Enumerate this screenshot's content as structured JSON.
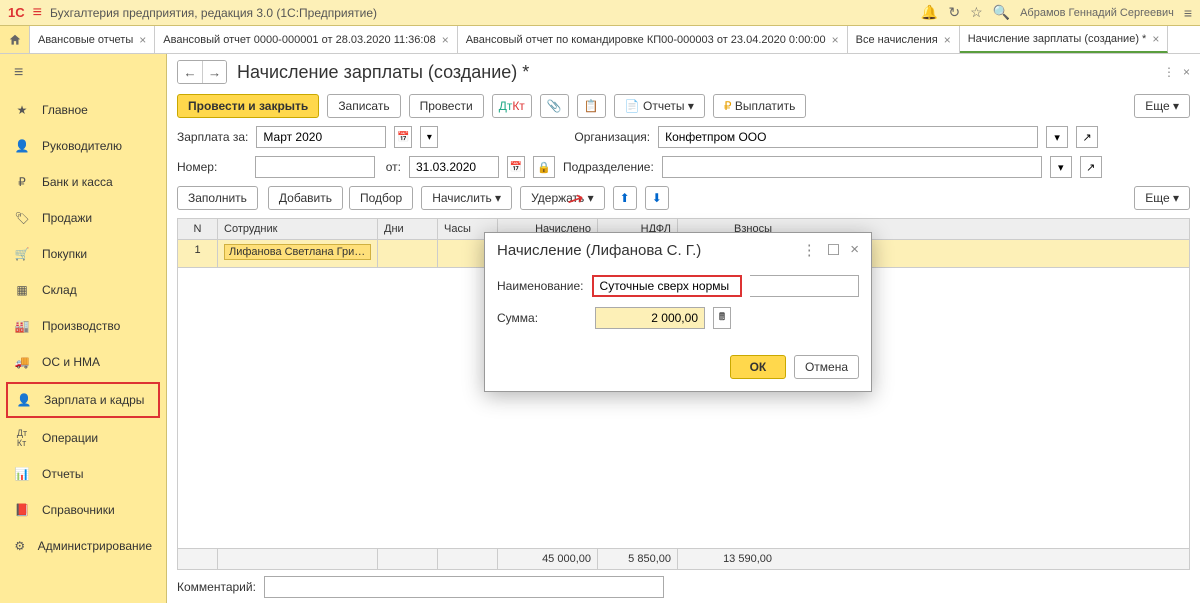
{
  "app": {
    "title": "Бухгалтерия предприятия, редакция 3.0   (1С:Предприятие)",
    "logo": "1C",
    "user": "Абрамов Геннадий Сергеевич"
  },
  "tabs": [
    {
      "label": "Авансовые отчеты"
    },
    {
      "label": "Авансовый отчет 0000-000001 от 28.03.2020 11:36:08"
    },
    {
      "label": "Авансовый отчет по командировке КП00-000003 от 23.04.2020 0:00:00"
    },
    {
      "label": "Все начисления"
    },
    {
      "label": "Начисление зарплаты (создание) *",
      "active": true
    }
  ],
  "sidebar": {
    "items": [
      {
        "label": "Главное",
        "icon": "star"
      },
      {
        "label": "Руководителю",
        "icon": "person"
      },
      {
        "label": "Банк и касса",
        "icon": "coin"
      },
      {
        "label": "Продажи",
        "icon": "sale"
      },
      {
        "label": "Покупки",
        "icon": "cart"
      },
      {
        "label": "Склад",
        "icon": "warehouse"
      },
      {
        "label": "Производство",
        "icon": "factory"
      },
      {
        "label": "ОС и НМА",
        "icon": "truck"
      },
      {
        "label": "Зарплата и кадры",
        "icon": "person2",
        "highlighted": true
      },
      {
        "label": "Операции",
        "icon": "dtkt"
      },
      {
        "label": "Отчеты",
        "icon": "chart"
      },
      {
        "label": "Справочники",
        "icon": "book"
      },
      {
        "label": "Администрирование",
        "icon": "gear"
      }
    ]
  },
  "page": {
    "title": "Начисление зарплаты (создание) *",
    "buttons": {
      "runClose": "Провести и закрыть",
      "write": "Записать",
      "run": "Провести",
      "reports": "Отчеты",
      "pay": "Выплатить",
      "more": "Еще"
    },
    "form": {
      "periodLabel": "Зарплата за:",
      "period": "Март 2020",
      "orgLabel": "Организация:",
      "org": "Конфетпром ООО",
      "numberLabel": "Номер:",
      "number": "",
      "fromLabel": "от:",
      "date": "31.03.2020",
      "deptLabel": "Подразделение:",
      "dept": ""
    },
    "tableBtns": {
      "fill": "Заполнить",
      "add": "Добавить",
      "pick": "Подбор",
      "accrue": "Начислить",
      "withhold": "Удержать",
      "more": "Еще"
    },
    "grid": {
      "headers": {
        "n": "N",
        "emp": "Сотрудник",
        "days": "Дни",
        "hours": "Часы",
        "accr": "Начислено",
        "ndfl": "НДФЛ",
        "vzn": "Взносы"
      },
      "rows": [
        {
          "n": "1",
          "emp": "Лифанова Светлана Григ..."
        }
      ],
      "totals": {
        "accr": "45 000,00",
        "ndfl": "5 850,00",
        "vzn": "13 590,00"
      }
    },
    "commentLabel": "Комментарий:",
    "comment": ""
  },
  "dialog": {
    "title": "Начисление (Лифанова С. Г.)",
    "nameLabel": "Наименование:",
    "nameValue": "Суточные сверх нормы",
    "sumLabel": "Сумма:",
    "sumValue": "2 000,00",
    "ok": "ОК",
    "cancel": "Отмена"
  }
}
